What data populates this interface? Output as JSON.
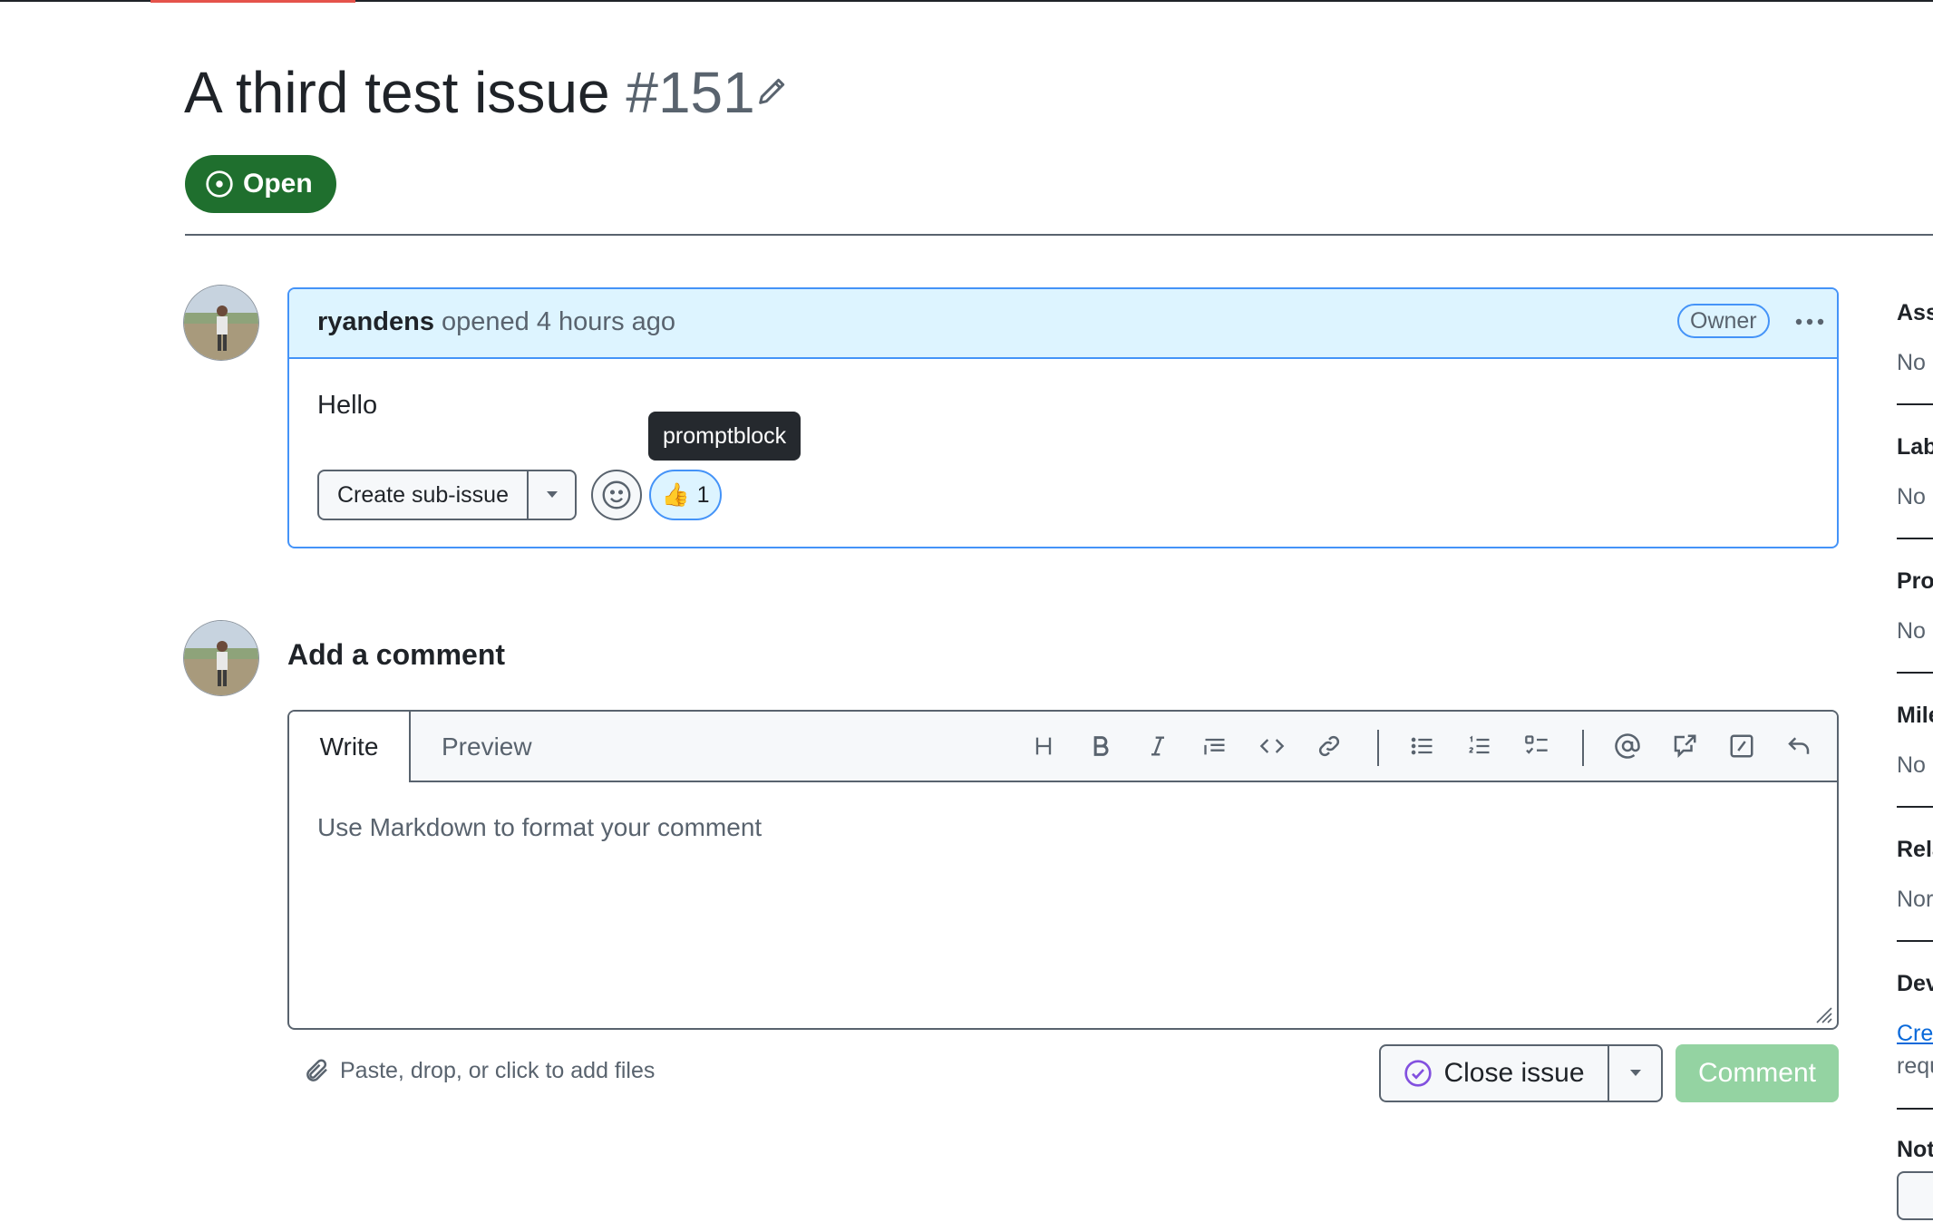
{
  "issue": {
    "title": "A third test issue",
    "number": "#151",
    "state": "Open"
  },
  "comment": {
    "author": "ryandens",
    "meta": "opened 4 hours ago",
    "role_badge": "Owner",
    "body": "Hello",
    "create_sub_issue_label": "Create sub-issue",
    "reaction_emoji": "👍",
    "reaction_count": "1",
    "tooltip": "promptblock"
  },
  "composer": {
    "heading": "Add a comment",
    "tabs": [
      "Write",
      "Preview"
    ],
    "placeholder": "Use Markdown to format your comment",
    "attach_hint": "Paste, drop, or click to add files",
    "close_issue_label": "Close issue",
    "comment_label": "Comment",
    "toolbar_icons": [
      "heading-icon",
      "bold-icon",
      "italic-icon",
      "quote-icon",
      "code-icon",
      "link-icon",
      "unordered-list-icon",
      "ordered-list-icon",
      "task-list-icon",
      "mention-icon",
      "reference-icon",
      "slash-command-icon",
      "undo-icon"
    ]
  },
  "sidebar": {
    "sections": [
      {
        "label": "Ass",
        "value": "No"
      },
      {
        "label": "Lab",
        "value": "No"
      },
      {
        "label": "Pro",
        "value": "No"
      },
      {
        "label": "Mile",
        "value": "No"
      },
      {
        "label": "Rela",
        "value": "Nor"
      },
      {
        "label": "Dev",
        "link": "Cre",
        "value": "requ"
      },
      {
        "label": "Not"
      }
    ]
  },
  "colors": {
    "open_state": "#1f6f2e",
    "accent_blue": "#4493f8",
    "comment_disabled": "#94d3a2",
    "close_icon": "#8250df"
  }
}
